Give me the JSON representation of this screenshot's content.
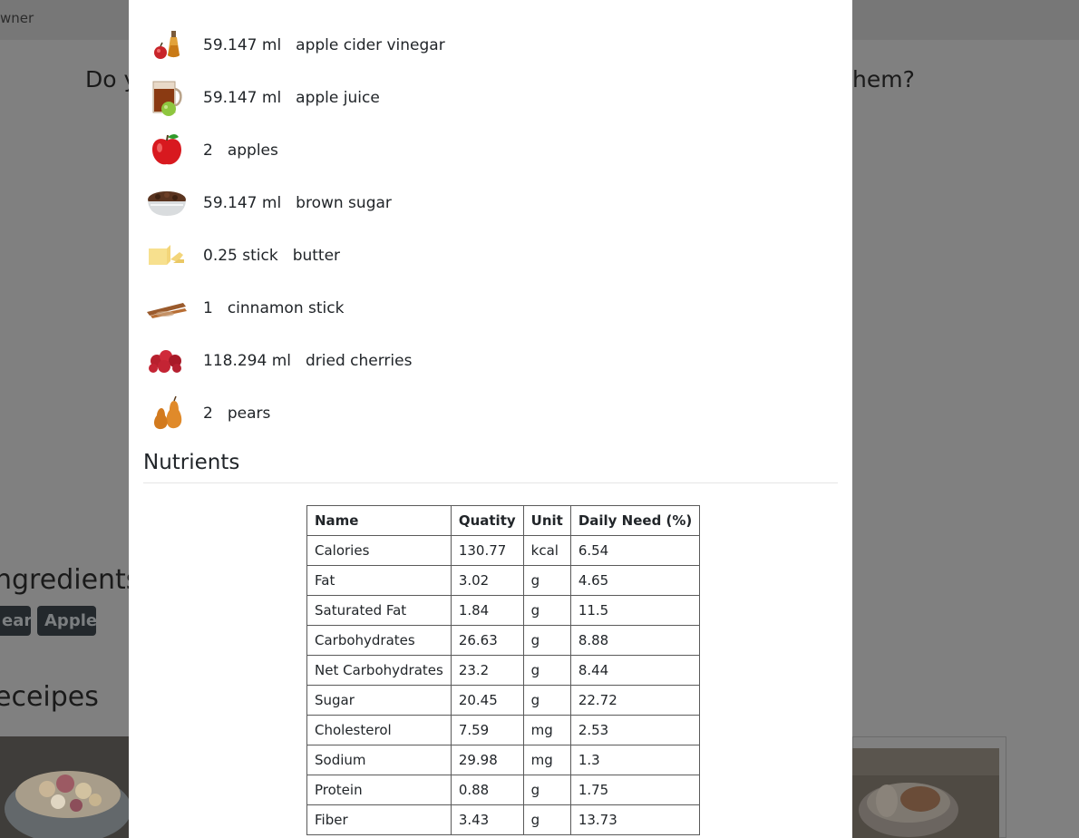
{
  "background": {
    "owner_fragment": "wner",
    "question_left": "Do y",
    "question_right": "hem?",
    "ingredients_heading": "ngredients",
    "tags": [
      "ear",
      "Apple"
    ],
    "recipes_heading": "eceipes"
  },
  "modal": {
    "ingredients": [
      {
        "qty": "59.147 ml",
        "name": "apple cider vinegar",
        "icon": "vinegar-bottle-icon"
      },
      {
        "qty": "59.147 ml",
        "name": "apple juice",
        "icon": "juice-pitcher-icon"
      },
      {
        "qty": "2",
        "name": "apples",
        "icon": "apple-icon"
      },
      {
        "qty": "59.147 ml",
        "name": "brown sugar",
        "icon": "brown-sugar-bowl-icon"
      },
      {
        "qty": "0.25 stick",
        "name": "butter",
        "icon": "butter-icon"
      },
      {
        "qty": "1",
        "name": "cinnamon stick",
        "icon": "cinnamon-stick-icon"
      },
      {
        "qty": "118.294 ml",
        "name": "dried cherries",
        "icon": "dried-cherries-icon"
      },
      {
        "qty": "2",
        "name": "pears",
        "icon": "pear-icon"
      }
    ],
    "nutrients_title": "Nutrients",
    "table": {
      "headers": [
        "Name",
        "Quatity",
        "Unit",
        "Daily Need (%)"
      ],
      "rows": [
        [
          "Calories",
          "130.77",
          "kcal",
          "6.54"
        ],
        [
          "Fat",
          "3.02",
          "g",
          "4.65"
        ],
        [
          "Saturated Fat",
          "1.84",
          "g",
          "11.5"
        ],
        [
          "Carbohydrates",
          "26.63",
          "g",
          "8.88"
        ],
        [
          "Net Carbohydrates",
          "23.2",
          "g",
          "8.44"
        ],
        [
          "Sugar",
          "20.45",
          "g",
          "22.72"
        ],
        [
          "Cholesterol",
          "7.59",
          "mg",
          "2.53"
        ],
        [
          "Sodium",
          "29.98",
          "mg",
          "1.3"
        ],
        [
          "Protein",
          "0.88",
          "g",
          "1.75"
        ],
        [
          "Fiber",
          "3.43",
          "g",
          "13.73"
        ]
      ]
    }
  }
}
